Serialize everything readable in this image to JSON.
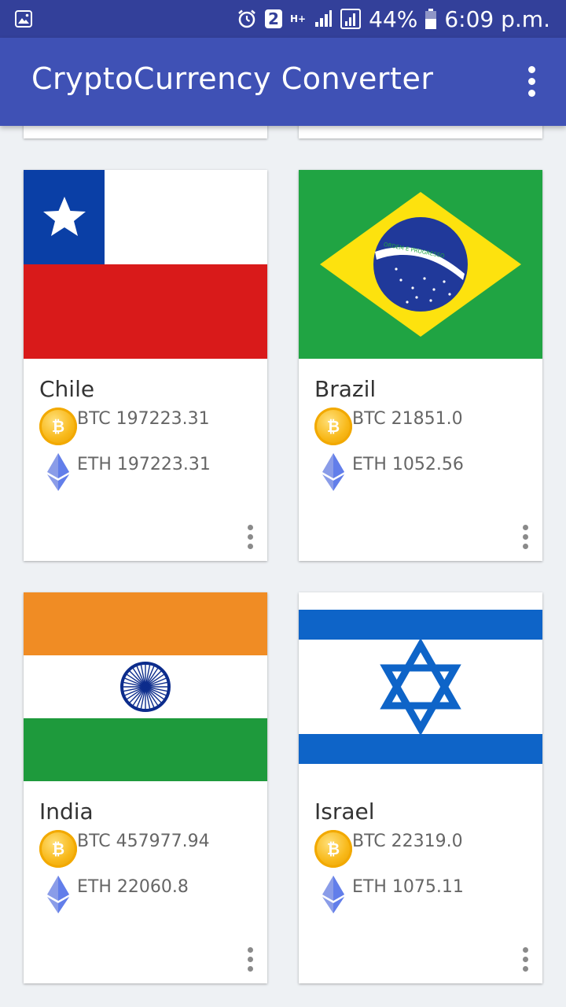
{
  "status_bar": {
    "notification_badge": "2",
    "network_label": "H+",
    "battery": "44%",
    "time": "6:09 p.m."
  },
  "app_bar": {
    "title": "CryptoCurrency Converter",
    "menu_icon": "more-vert-icon"
  },
  "cards": [
    {
      "country": "Chile",
      "flag_icon": "chile-flag",
      "btc": "BTC 197223.31",
      "eth": "ETH 197223.31"
    },
    {
      "country": "Brazil",
      "flag_icon": "brazil-flag",
      "flag_motto": "ORDEM E PROGRESSO",
      "btc": "BTC 21851.0",
      "eth": "ETH 1052.56"
    },
    {
      "country": "India",
      "flag_icon": "india-flag",
      "btc": "BTC 457977.94",
      "eth": "ETH 22060.8"
    },
    {
      "country": "Israel",
      "flag_icon": "israel-flag",
      "btc": "BTC 22319.0",
      "eth": "ETH 1075.11"
    }
  ],
  "colors": {
    "status_bar": "#33409a",
    "app_bar": "#3f51b5",
    "background": "#eef1f4",
    "bitcoin": "#f7a600",
    "ethereum": "#627eea"
  }
}
